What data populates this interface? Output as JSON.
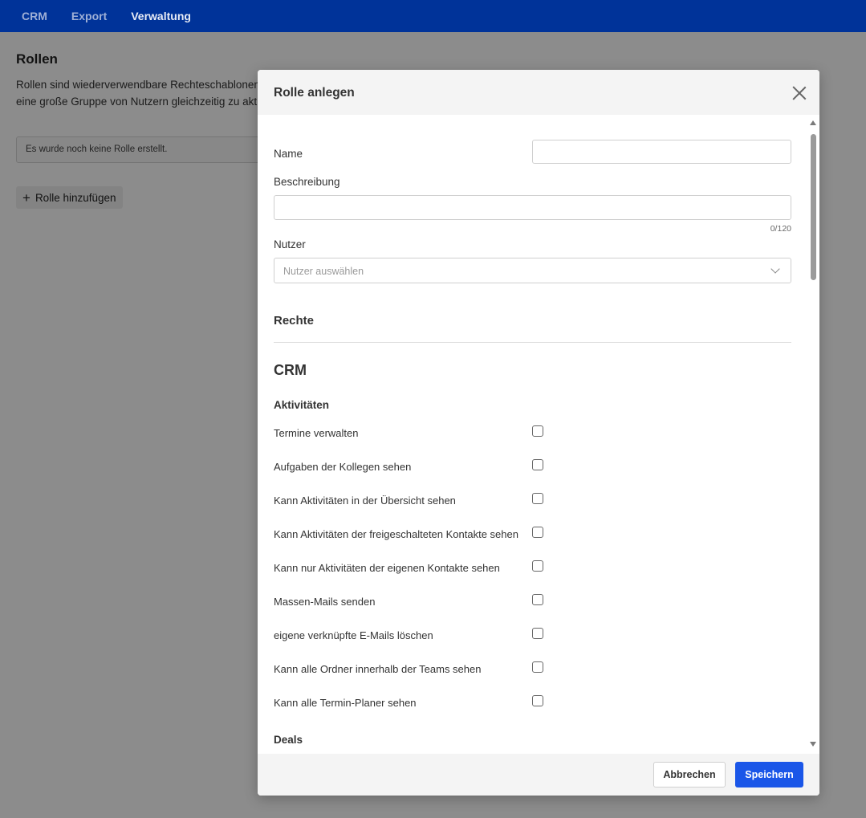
{
  "nav": {
    "items": [
      {
        "label": "CRM",
        "active": false
      },
      {
        "label": "Export",
        "active": false
      },
      {
        "label": "Verwaltung",
        "active": true
      }
    ]
  },
  "page": {
    "title": "Rollen",
    "description_line1": "Rollen sind wiederverwendbare Rechteschablonen",
    "description_line2": "eine große Gruppe von Nutzern gleichzeitig zu akt",
    "empty_text": "Es wurde noch keine Rolle erstellt.",
    "add_button": "Rolle hinzufügen"
  },
  "modal": {
    "title": "Rolle anlegen",
    "name_label": "Name",
    "name_value": "",
    "description_label": "Beschreibung",
    "description_value": "",
    "description_counter": "0/120",
    "users_label": "Nutzer",
    "users_placeholder": "Nutzer auswählen",
    "rights_heading": "Rechte",
    "crm_heading": "CRM",
    "groups": [
      {
        "heading": "Aktivitäten",
        "permissions": [
          {
            "label": "Termine verwalten",
            "checked": false
          },
          {
            "label": "Aufgaben der Kollegen sehen",
            "checked": false
          },
          {
            "label": "Kann Aktivitäten in der Übersicht sehen",
            "checked": false
          },
          {
            "label": "Kann Aktivitäten der freigeschalteten Kontakte sehen",
            "checked": false
          },
          {
            "label": "Kann nur Aktivitäten der eigenen Kontakte sehen",
            "checked": false
          },
          {
            "label": "Massen-Mails senden",
            "checked": false
          },
          {
            "label": "eigene verknüpfte E-Mails löschen",
            "checked": false
          },
          {
            "label": "Kann alle Ordner innerhalb der Teams sehen",
            "checked": false
          },
          {
            "label": "Kann alle Termin-Planer sehen",
            "checked": false
          }
        ]
      },
      {
        "heading": "Deals",
        "permissions": []
      }
    ],
    "cancel_label": "Abbrechen",
    "save_label": "Speichern"
  }
}
